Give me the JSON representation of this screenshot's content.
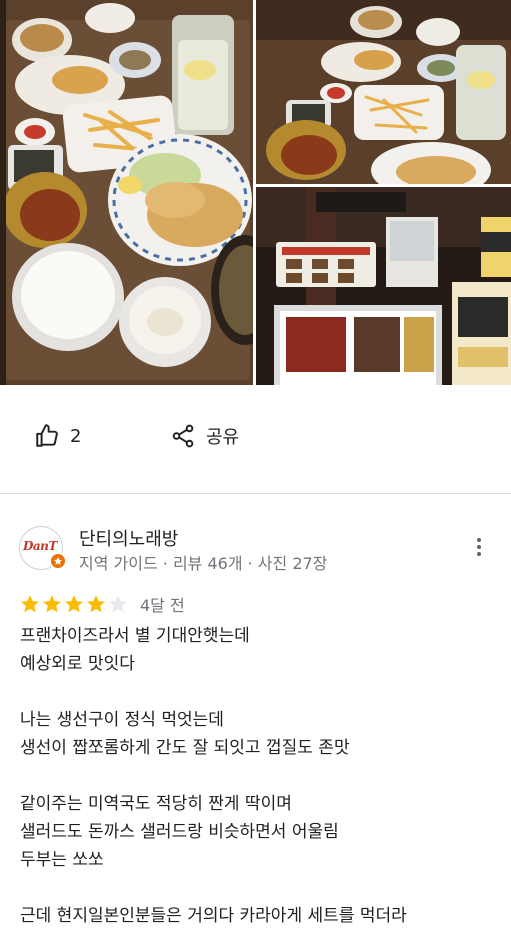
{
  "photos": [
    {
      "name": "main-food-photo"
    },
    {
      "name": "top-right-food-photo"
    },
    {
      "name": "bottom-right-menu-photo"
    }
  ],
  "actions": {
    "like_count": "2",
    "share_label": "공유"
  },
  "reviewer": {
    "avatar_text": "DanT",
    "name": "단티의노래방",
    "meta": "지역 가이드 · 리뷰 46개 · 사진 27장"
  },
  "review": {
    "rating": 4,
    "max_rating": 5,
    "time": "4달 전",
    "lines": [
      "프랜차이즈라서 별 기대안햇는데",
      "예상외로 맛잇다",
      "",
      "나는 생선구이 정식 먹엇는데",
      "생선이 짭쪼롬하게 간도 잘 되잇고 껍질도 존맛",
      "",
      "같이주는 미역국도 적당히 짠게 딱이며",
      "샐러드도 돈까스 샐러드랑 비슷하면서 어울림",
      "두부는 쏘쏘",
      "",
      "근데 현지일본인분들은 거의다 카라아게 세트를 먹더라"
    ]
  },
  "colors": {
    "star_filled": "#fbbc04",
    "star_empty": "#e8eaed",
    "text_primary": "#202124",
    "text_secondary": "#70757a",
    "badge": "#e8710a"
  },
  "icons": {
    "like": "thumbs-up-icon",
    "share": "share-icon",
    "more": "more-vert-icon",
    "badge": "local-guide-star-icon"
  }
}
